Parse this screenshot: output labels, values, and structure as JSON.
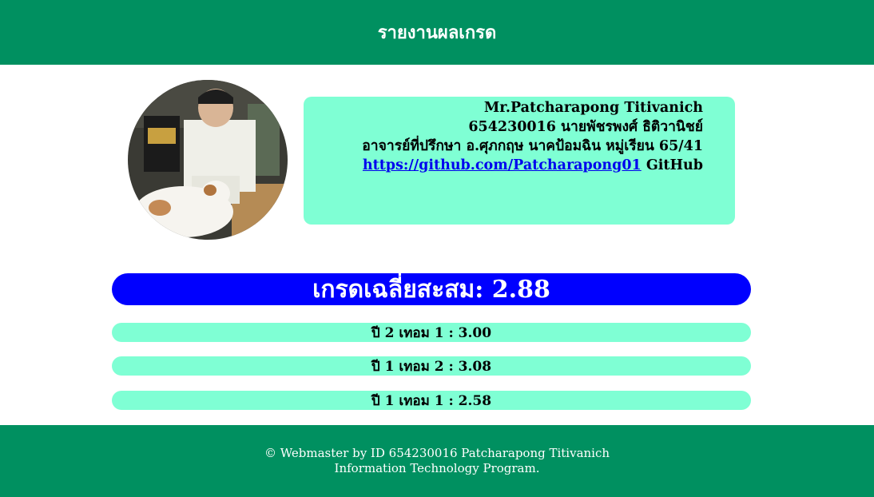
{
  "header": {
    "title": "รายงานผลเกรด"
  },
  "profile": {
    "name_en": "Mr.Patcharapong Titivanich",
    "id_name_th": "654230016 นายพัชรพงศ์ ธิติวานิชย์",
    "advisor_group": "อาจารย์ที่ปรึกษา อ.ศุภกฤษ นาคป้อมฉิน หมู่เรียน 65/41",
    "github_url": "https://github.com/Patcharapong01",
    "github_label": "GitHub"
  },
  "gpa": {
    "label": "เกรดเฉลี่ยสะสม: 2.88"
  },
  "terms": [
    {
      "label": "ปี 2 เทอม 1 : 3.00"
    },
    {
      "label": "ปี 1 เทอม 2 : 3.08"
    },
    {
      "label": "ปี 1 เทอม 1 : 2.58"
    }
  ],
  "footer": {
    "line1": "© Webmaster by ID 654230016 Patcharapong Titivanich",
    "line2": "Information Technology Program."
  },
  "colors": {
    "header_bg": "#009060",
    "card_bg": "#7fffd4",
    "gpa_bg": "#0000ff"
  }
}
